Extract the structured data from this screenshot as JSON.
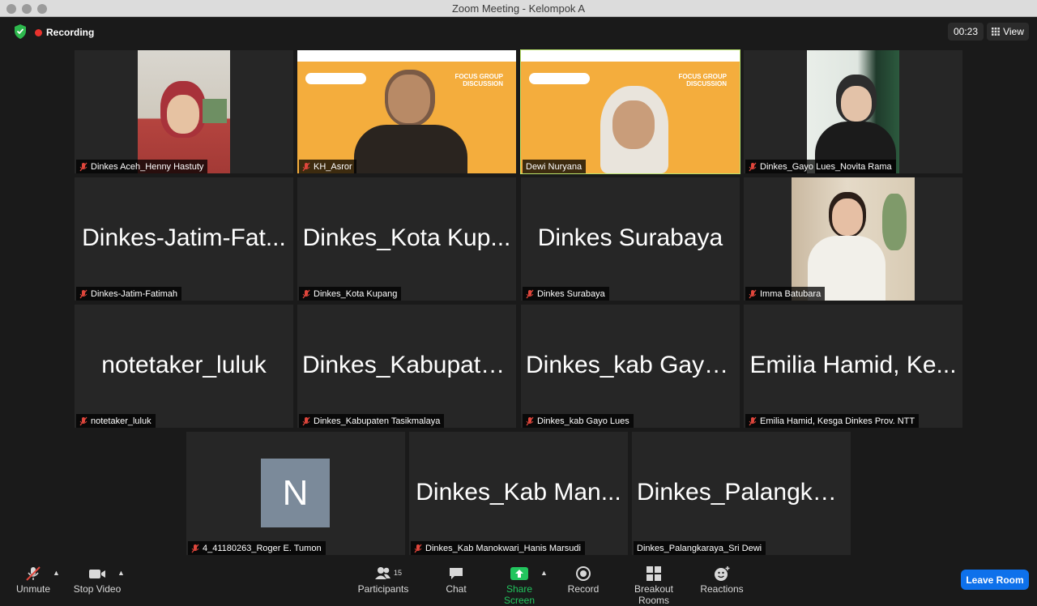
{
  "window": {
    "title": "Zoom Meeting - Kelompok A"
  },
  "topbar": {
    "recording_label": "Recording",
    "timer": "00:23",
    "view_label": "View"
  },
  "slide": {
    "title_line1": "FOCUS GROUP",
    "title_line2": "DISCUSSION"
  },
  "tiles": [
    {
      "label": "Dinkes Aceh_Henny Hastuty",
      "big": ""
    },
    {
      "label": "KH_Asror",
      "big": ""
    },
    {
      "label": "Dewi Nuryana",
      "big": ""
    },
    {
      "label": "Dinkes_Gayo Lues_Novita Rama",
      "big": ""
    },
    {
      "label": "Dinkes-Jatim-Fatimah",
      "big": "Dinkes-Jatim-Fat..."
    },
    {
      "label": "Dinkes_Kota Kupang",
      "big": "Dinkes_Kota Kup..."
    },
    {
      "label": "Dinkes Surabaya",
      "big": "Dinkes Surabaya"
    },
    {
      "label": "Imma Batubara",
      "big": ""
    },
    {
      "label": "notetaker_luluk",
      "big": "notetaker_luluk"
    },
    {
      "label": "Dinkes_Kabupaten Tasikmalaya",
      "big": "Dinkes_Kabupate..."
    },
    {
      "label": "Dinkes_kab Gayo Lues",
      "big": "Dinkes_kab Gayo..."
    },
    {
      "label": "Emilia Hamid, Kesga Dinkes Prov. NTT",
      "big": "Emilia Hamid, Ke..."
    },
    {
      "label": "4_41180263_Roger E. Tumon",
      "avatar_letter": "N"
    },
    {
      "label": "Dinkes_Kab Manokwari_Hanis Marsudi",
      "big": "Dinkes_Kab Man..."
    },
    {
      "label": "Dinkes_Palangkaraya_Sri Dewi",
      "big": "Dinkes_Palangka..."
    }
  ],
  "toolbar": {
    "unmute": "Unmute",
    "stop_video": "Stop Video",
    "participants": "Participants",
    "participants_count": "15",
    "chat": "Chat",
    "share_screen": "Share Screen",
    "record": "Record",
    "breakout_rooms": "Breakout Rooms",
    "reactions": "Reactions",
    "leave": "Leave Room"
  },
  "colors": {
    "accent_blue": "#0e71eb",
    "share_green": "#22c55e",
    "recording_red": "#e8322d",
    "active_speaker": "#b9e36b"
  }
}
